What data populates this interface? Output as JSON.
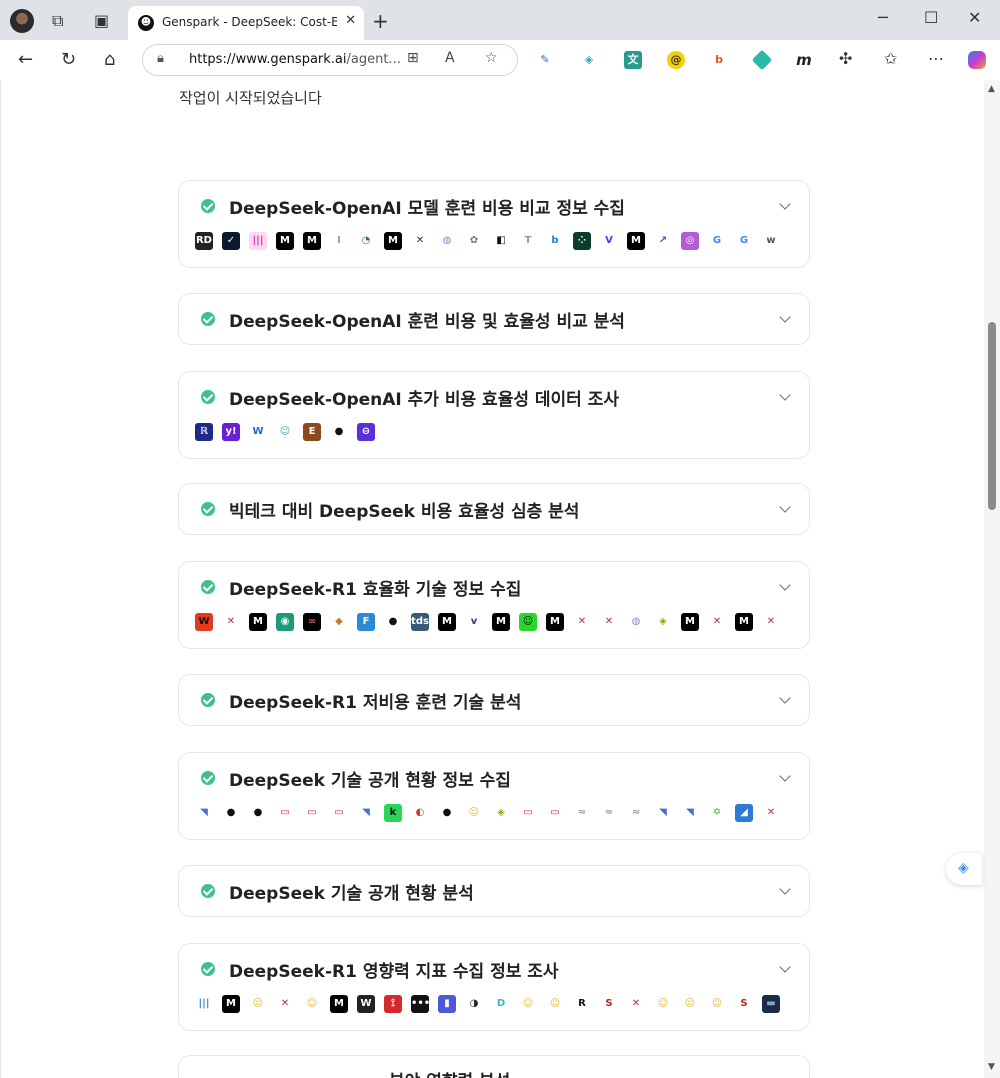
{
  "browser": {
    "tab_title": "Genspark - DeepSeek: Cost-Effect",
    "url_host": "https://www.genspark.ai",
    "url_path": "/agent...",
    "tab_close": "✕",
    "new_tab": "+"
  },
  "page": {
    "status_text": "작업이 시작되었습니다",
    "tasks": [
      {
        "title": "DeepSeek-OpenAI 모델 훈련 비용 비교 정보 수집",
        "sources": [
          {
            "g": "RD",
            "bg": "#222",
            "fg": "#fff"
          },
          {
            "g": "✓",
            "bg": "#0b1a2b",
            "fg": "#fff"
          },
          {
            "g": "|||",
            "bg": "#ffd7f0",
            "fg": "#c93aa8"
          },
          {
            "g": "M",
            "bg": "#000",
            "fg": "#fff"
          },
          {
            "g": "M",
            "bg": "#000",
            "fg": "#fff"
          },
          {
            "g": "I",
            "bg": "#fff",
            "fg": "#7aa7d9"
          },
          {
            "g": "◔",
            "bg": "#fff",
            "fg": "#0a8a3a"
          },
          {
            "g": "M",
            "bg": "#000",
            "fg": "#fff"
          },
          {
            "g": "✕",
            "bg": "#fff",
            "fg": "#333"
          },
          {
            "g": "◍",
            "bg": "#fff",
            "fg": "#7a8ccf"
          },
          {
            "g": "✿",
            "bg": "#fff",
            "fg": "#777"
          },
          {
            "g": "◧",
            "bg": "#fff",
            "fg": "#111"
          },
          {
            "g": "T",
            "bg": "#fff",
            "fg": "#999"
          },
          {
            "g": "b",
            "bg": "#fff",
            "fg": "#1c7ed6"
          },
          {
            "g": "⁘",
            "bg": "#0b3d2e",
            "fg": "#fff"
          },
          {
            "g": "V",
            "bg": "#fff",
            "fg": "#6b2fd6"
          },
          {
            "g": "M",
            "bg": "#000",
            "fg": "#fff"
          },
          {
            "g": "↗",
            "bg": "#fff",
            "fg": "#2557d6"
          },
          {
            "g": "◎",
            "bg": "#b45bd6",
            "fg": "#fff"
          },
          {
            "g": "G",
            "bg": "#fff",
            "fg": "#4285f4"
          },
          {
            "g": "G",
            "bg": "#fff",
            "fg": "#4285f4"
          },
          {
            "g": "w",
            "bg": "#fff",
            "fg": "#555"
          }
        ]
      },
      {
        "title": "DeepSeek-OpenAI 훈련 비용 및 효율성 비교 분석",
        "sources": []
      },
      {
        "title": "DeepSeek-OpenAI 추가 비용 효율성 데이터 조사",
        "sources": [
          {
            "g": "ℝ",
            "bg": "#1e2a8a",
            "fg": "#fff"
          },
          {
            "g": "y!",
            "bg": "#6a1fd1",
            "fg": "#fff"
          },
          {
            "g": "W",
            "bg": "#fff",
            "fg": "#1a6ad6"
          },
          {
            "g": "☺",
            "bg": "#fff",
            "fg": "#3ba7b8"
          },
          {
            "g": "E",
            "bg": "#8a4a1e",
            "fg": "#fff"
          },
          {
            "g": "●",
            "bg": "#fff",
            "fg": "#111"
          },
          {
            "g": "⊖",
            "bg": "#5a2fd6",
            "fg": "#fff"
          }
        ]
      },
      {
        "title": "빅테크 대비 DeepSeek 비용 효율성 심층 분석",
        "sources": []
      },
      {
        "title": "DeepSeek-R1 효율화 기술 정보 수집",
        "sources": [
          {
            "g": "W",
            "bg": "#e53a1e",
            "fg": "#111"
          },
          {
            "g": "✕",
            "bg": "#fff",
            "fg": "#b33"
          },
          {
            "g": "M",
            "bg": "#000",
            "fg": "#fff"
          },
          {
            "g": "◉",
            "bg": "#1e9a7a",
            "fg": "#fff"
          },
          {
            "g": "∞",
            "bg": "#000",
            "fg": "#e55"
          },
          {
            "g": "◆",
            "bg": "#fff",
            "fg": "#c77a2a"
          },
          {
            "g": "F",
            "bg": "#2a8ad6",
            "fg": "#fff"
          },
          {
            "g": "●",
            "bg": "#fff",
            "fg": "#111"
          },
          {
            "g": "tds",
            "bg": "#3a5a7a",
            "fg": "#fff"
          },
          {
            "g": "M",
            "bg": "#000",
            "fg": "#fff"
          },
          {
            "g": "v",
            "bg": "#fff",
            "fg": "#4a2a8a"
          },
          {
            "g": "M",
            "bg": "#000",
            "fg": "#fff"
          },
          {
            "g": "☺",
            "bg": "#2ad62a",
            "fg": "#111"
          },
          {
            "g": "M",
            "bg": "#000",
            "fg": "#fff"
          },
          {
            "g": "✕",
            "bg": "#fff",
            "fg": "#b33"
          },
          {
            "g": "✕",
            "bg": "#fff",
            "fg": "#b33"
          },
          {
            "g": "◍",
            "bg": "#fff",
            "fg": "#7a8ccf"
          },
          {
            "g": "◈",
            "bg": "#fff",
            "fg": "#76b900"
          },
          {
            "g": "M",
            "bg": "#000",
            "fg": "#fff"
          },
          {
            "g": "✕",
            "bg": "#fff",
            "fg": "#b33"
          },
          {
            "g": "M",
            "bg": "#000",
            "fg": "#fff"
          },
          {
            "g": "✕",
            "bg": "#fff",
            "fg": "#b33"
          }
        ]
      },
      {
        "title": "DeepSeek-R1 저비용 훈련 기술 분석",
        "sources": []
      },
      {
        "title": "DeepSeek 기술 공개 현황 정보 수집",
        "sources": [
          {
            "g": "◥",
            "bg": "#fff",
            "fg": "#4a6ad6"
          },
          {
            "g": "●",
            "bg": "#fff",
            "fg": "#111"
          },
          {
            "g": "●",
            "bg": "#fff",
            "fg": "#111"
          },
          {
            "g": "▭",
            "bg": "#fff",
            "fg": "#d62a2a"
          },
          {
            "g": "▭",
            "bg": "#fff",
            "fg": "#d62a2a"
          },
          {
            "g": "▭",
            "bg": "#fff",
            "fg": "#d62a2a"
          },
          {
            "g": "◥",
            "bg": "#fff",
            "fg": "#4a6ad6"
          },
          {
            "g": "k",
            "bg": "#2ad65a",
            "fg": "#111"
          },
          {
            "g": "◐",
            "bg": "#fff",
            "fg": "#d63a1e"
          },
          {
            "g": "●",
            "bg": "#fff",
            "fg": "#111"
          },
          {
            "g": "☺",
            "bg": "#fff",
            "fg": "#e5b92a"
          },
          {
            "g": "◈",
            "bg": "#fff",
            "fg": "#76b900"
          },
          {
            "g": "▭",
            "bg": "#fff",
            "fg": "#d62a2a"
          },
          {
            "g": "▭",
            "bg": "#fff",
            "fg": "#d62a2a"
          },
          {
            "g": "≈",
            "bg": "#fff",
            "fg": "#999"
          },
          {
            "g": "≈",
            "bg": "#fff",
            "fg": "#999"
          },
          {
            "g": "≈",
            "bg": "#fff",
            "fg": "#999"
          },
          {
            "g": "◥",
            "bg": "#fff",
            "fg": "#4a6ad6"
          },
          {
            "g": "◥",
            "bg": "#fff",
            "fg": "#4a6ad6"
          },
          {
            "g": "✡",
            "bg": "#fff",
            "fg": "#2ab82a"
          },
          {
            "g": "◢",
            "bg": "#2a7ad6",
            "fg": "#fff"
          },
          {
            "g": "✕",
            "bg": "#fff",
            "fg": "#b33"
          }
        ]
      },
      {
        "title": "DeepSeek 기술 공개 현황 분석",
        "sources": []
      },
      {
        "title": "DeepSeek-R1 영향력 지표 수집 정보 조사",
        "sources": [
          {
            "g": "|||",
            "bg": "#fff",
            "fg": "#2a8ad6"
          },
          {
            "g": "M",
            "bg": "#000",
            "fg": "#fff"
          },
          {
            "g": "☺",
            "bg": "#fff",
            "fg": "#e5b92a"
          },
          {
            "g": "✕",
            "bg": "#fff",
            "fg": "#b33"
          },
          {
            "g": "☺",
            "bg": "#fff",
            "fg": "#e5b92a"
          },
          {
            "g": "M",
            "bg": "#000",
            "fg": "#fff"
          },
          {
            "g": "W",
            "bg": "#222",
            "fg": "#fff"
          },
          {
            "g": "⟟",
            "bg": "#d62a2a",
            "fg": "#fff"
          },
          {
            "g": "•••",
            "bg": "#111",
            "fg": "#fff"
          },
          {
            "g": "▮",
            "bg": "#4a5ad6",
            "fg": "#fff"
          },
          {
            "g": "◑",
            "bg": "#fff",
            "fg": "#222"
          },
          {
            "g": "D",
            "bg": "#fff",
            "fg": "#3ab8c8"
          },
          {
            "g": "☺",
            "bg": "#fff",
            "fg": "#e5b92a"
          },
          {
            "g": "☺",
            "bg": "#fff",
            "fg": "#e5b92a"
          },
          {
            "g": "R",
            "bg": "#fff",
            "fg": "#111"
          },
          {
            "g": "S",
            "bg": "#fff",
            "fg": "#b32a2a"
          },
          {
            "g": "✕",
            "bg": "#fff",
            "fg": "#b33"
          },
          {
            "g": "☺",
            "bg": "#fff",
            "fg": "#e5b92a"
          },
          {
            "g": "☺",
            "bg": "#fff",
            "fg": "#e5b92a"
          },
          {
            "g": "☺",
            "bg": "#fff",
            "fg": "#e5b92a"
          },
          {
            "g": "S",
            "bg": "#fff",
            "fg": "#b32a2a"
          },
          {
            "g": "▬",
            "bg": "#1a2a4a",
            "fg": "#8ab"
          }
        ]
      }
    ],
    "partial_card_title": "분야 영향력 분석"
  }
}
